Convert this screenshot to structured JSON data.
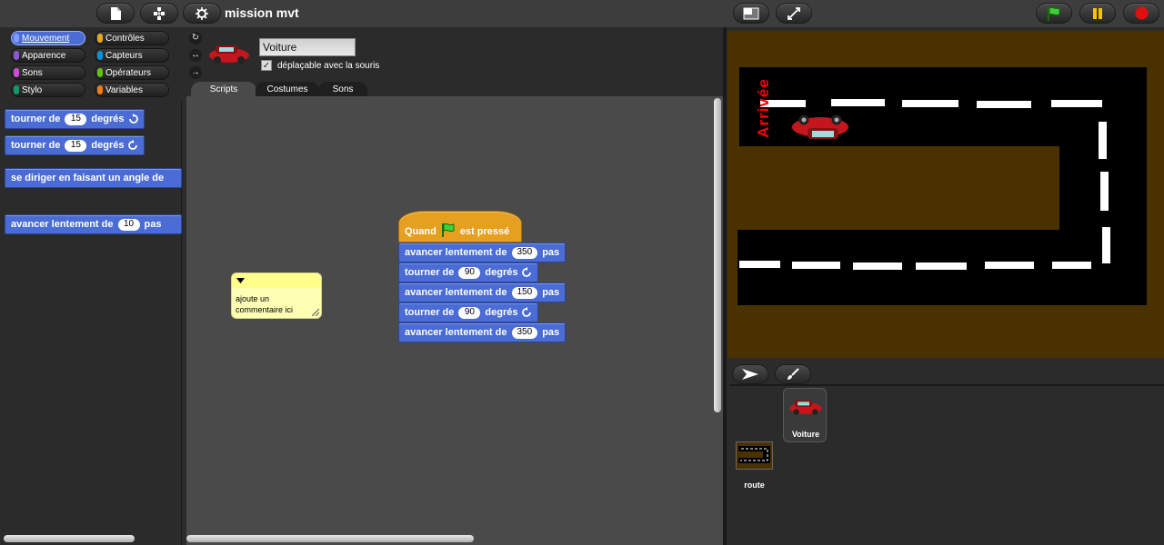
{
  "project": {
    "title": "mission mvt"
  },
  "toolbar": {
    "new_icon": "page-icon",
    "cloud_icon": "cloud-icon",
    "settings_icon": "gear-icon"
  },
  "stage_controls": {
    "stage_size_icon": "stage-size-icon",
    "fullscreen_icon": "fullscreen-icon",
    "green_flag_icon": "green-flag-icon",
    "pause_icon": "pause-icon",
    "stop_icon": "stop-icon"
  },
  "categories": [
    {
      "label": "Mouvement",
      "color": "#4a6cd4",
      "selected": true
    },
    {
      "label": "Contrôles",
      "color": "#e6a822",
      "selected": false
    },
    {
      "label": "Apparence",
      "color": "#8a55d7",
      "selected": false
    },
    {
      "label": "Capteurs",
      "color": "#0494dc",
      "selected": false
    },
    {
      "label": "Sons",
      "color": "#cf4ad9",
      "selected": false
    },
    {
      "label": "Opérateurs",
      "color": "#62c213",
      "selected": false
    },
    {
      "label": "Stylo",
      "color": "#0e9a6c",
      "selected": false
    },
    {
      "label": "Variables",
      "color": "#ee7d16",
      "selected": false
    }
  ],
  "palette_blocks": [
    {
      "text1": "tourner de",
      "value": "15",
      "text2": "degrés",
      "icon": "rotate-cw-icon"
    },
    {
      "text1": "tourner de",
      "value": "15",
      "text2": "degrés",
      "icon": "rotate-ccw-icon"
    },
    {
      "text1": "se diriger en faisant un angle de",
      "value": "",
      "text2": "",
      "icon": ""
    },
    {
      "text1": "avancer lentement de",
      "value": "10",
      "text2": "pas",
      "icon": ""
    }
  ],
  "sprite": {
    "name": "Voiture",
    "draggable_label": "déplaçable avec la souris",
    "draggable_checked": true
  },
  "tabs": [
    "Scripts",
    "Costumes",
    "Sons"
  ],
  "comment": {
    "text": "ajoute un commentaire ici"
  },
  "script": {
    "hat_prefix": "Quand",
    "hat_suffix": "est pressé",
    "blocks": [
      {
        "text1": "avancer lentement de",
        "value": "350",
        "text2": "pas",
        "icon": ""
      },
      {
        "text1": "tourner de",
        "value": "90",
        "text2": "degrés",
        "icon": "rotate-ccw-icon"
      },
      {
        "text1": "avancer lentement de",
        "value": "150",
        "text2": "pas",
        "icon": ""
      },
      {
        "text1": "tourner de",
        "value": "90",
        "text2": "degrés",
        "icon": "rotate-ccw-icon"
      },
      {
        "text1": "avancer lentement de",
        "value": "350",
        "text2": "pas",
        "icon": ""
      }
    ]
  },
  "stage": {
    "arrival_label": "Arrivée",
    "arrival_color": "#ff0000",
    "road_color": "#000000",
    "ground_color": "#4a3200",
    "marking_color": "#ffffff"
  },
  "corral": {
    "sprites": [
      {
        "name": "Voiture",
        "selected": true
      }
    ],
    "stage_name": "route"
  }
}
